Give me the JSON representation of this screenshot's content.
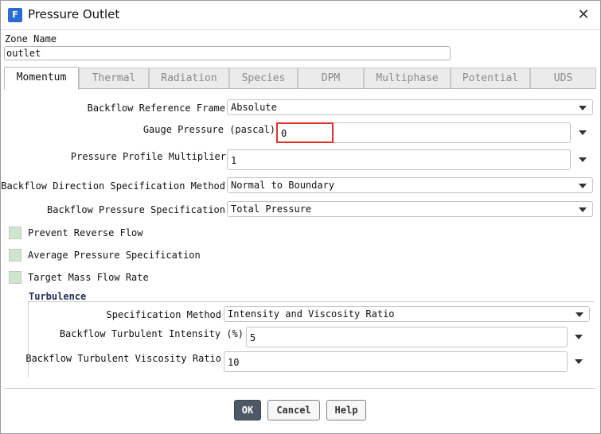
{
  "window": {
    "app_icon": "F",
    "title": "Pressure Outlet",
    "close_glyph": "✕"
  },
  "zone": {
    "label": "Zone Name",
    "value": "outlet"
  },
  "tabs": [
    {
      "label": "Momentum",
      "active": true
    },
    {
      "label": "Thermal",
      "active": false
    },
    {
      "label": "Radiation",
      "active": false
    },
    {
      "label": "Species",
      "active": false
    },
    {
      "label": "DPM",
      "active": false
    },
    {
      "label": "Multiphase",
      "active": false
    },
    {
      "label": "Potential",
      "active": false
    },
    {
      "label": "UDS",
      "active": false
    }
  ],
  "momentum": {
    "backflow_reference_frame": {
      "label": "Backflow Reference Frame",
      "value": "Absolute"
    },
    "gauge_pressure": {
      "label": "Gauge Pressure (pascal)",
      "value": "0"
    },
    "pressure_profile_multiplier": {
      "label": "Pressure Profile Multiplier",
      "value": "1"
    },
    "backflow_direction_method": {
      "label": "Backflow Direction Specification Method",
      "value": "Normal to Boundary"
    },
    "backflow_pressure_spec": {
      "label": "Backflow Pressure Specification",
      "value": "Total Pressure"
    },
    "checkboxes": [
      {
        "label": "Prevent Reverse Flow",
        "checked": false
      },
      {
        "label": "Average Pressure Specification",
        "checked": false
      },
      {
        "label": "Target Mass Flow Rate",
        "checked": false
      }
    ]
  },
  "turbulence": {
    "title": "Turbulence",
    "specification_method": {
      "label": "Specification Method",
      "value": "Intensity and Viscosity Ratio"
    },
    "backflow_intensity": {
      "label": "Backflow Turbulent Intensity (%)",
      "value": "5"
    },
    "backflow_viscosity_ratio": {
      "label": "Backflow Turbulent Viscosity Ratio",
      "value": "10"
    }
  },
  "buttons": {
    "ok": "OK",
    "cancel": "Cancel",
    "help": "Help"
  },
  "colors": {
    "accent_highlight": "#e8302a",
    "app_icon": "#2b6bd6",
    "checkbox_fill": "#cfe5cf",
    "ok_button": "#4d5965"
  }
}
